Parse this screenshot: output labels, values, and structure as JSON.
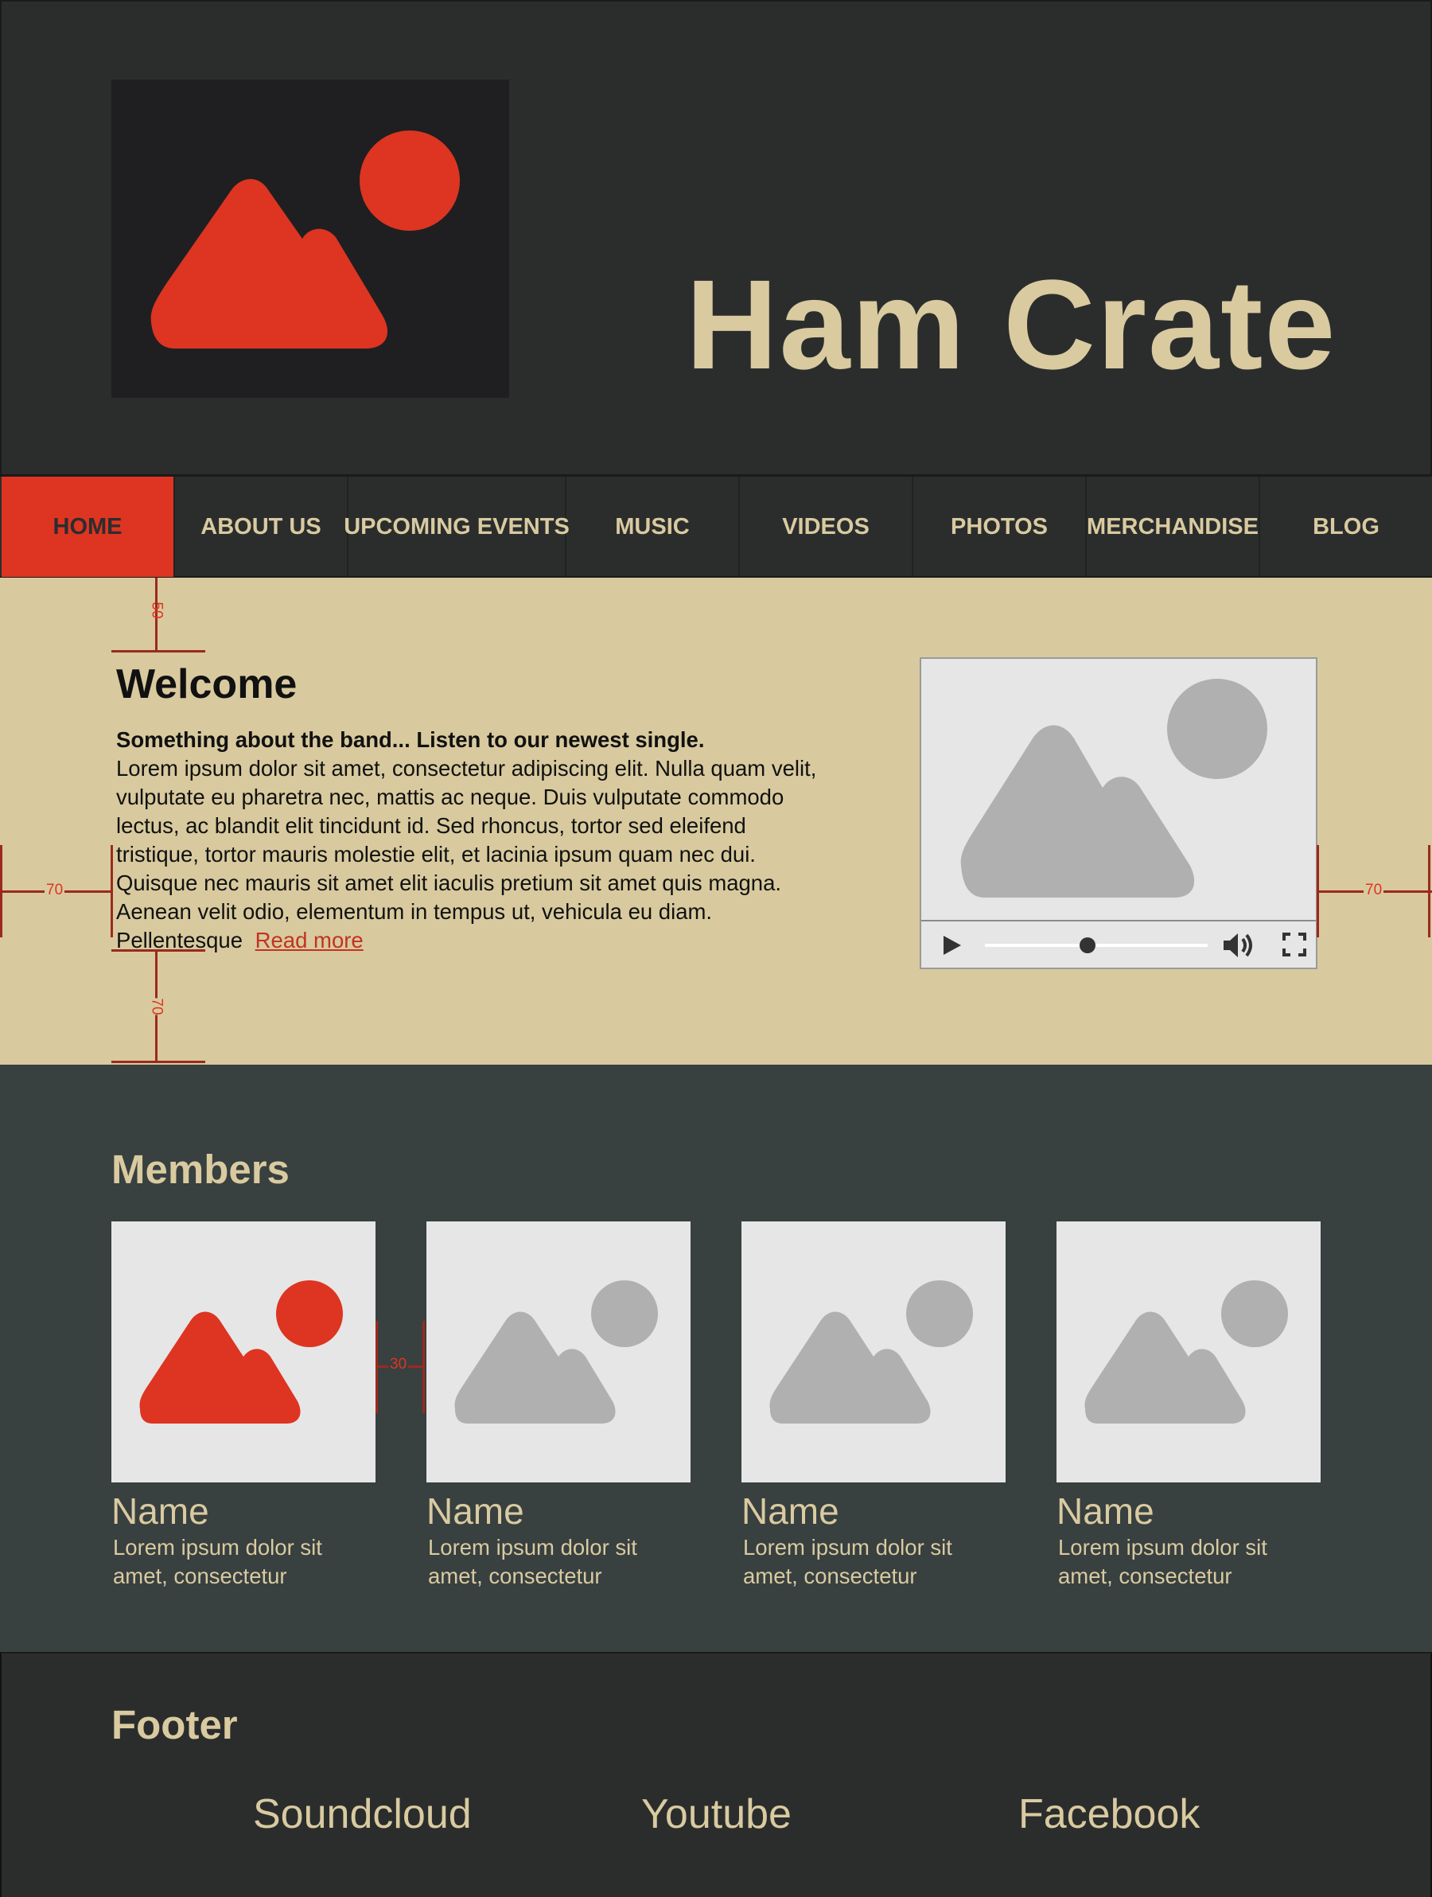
{
  "colors": {
    "background": "#2b2d2d",
    "accent": "#dd3522",
    "beige": "#d9caa0",
    "members_bg": "#384040"
  },
  "header": {
    "title": "Ham Crate",
    "logo_icon": "image-placeholder-icon"
  },
  "nav": {
    "items": [
      {
        "label": "HOME",
        "active": true
      },
      {
        "label": "ABOUT US",
        "active": false
      },
      {
        "label": "UPCOMING EVENTS",
        "active": false
      },
      {
        "label": "MUSIC",
        "active": false
      },
      {
        "label": "VIDEOS",
        "active": false
      },
      {
        "label": "PHOTOS",
        "active": false
      },
      {
        "label": "MERCHANDISE",
        "active": false
      },
      {
        "label": "BLOG",
        "active": false
      }
    ]
  },
  "welcome": {
    "title": "Welcome",
    "lead": "Something about the band... Listen to our newest single.",
    "body": "Lorem ipsum dolor sit amet, consectetur adipiscing elit. Nulla quam velit, vulputate eu pharetra nec, mattis ac neque. Duis vulputate commodo lectus, ac blandit elit tincidunt id. Sed rhoncus, tortor sed eleifend tristique, tortor mauris molestie elit, et lacinia ipsum quam nec dui. Quisque nec mauris sit amet elit iaculis pretium sit amet quis magna. Aenean velit odio, elementum in tempus ut, vehicula eu diam. Pellentesque",
    "read_more": "Read more"
  },
  "video": {
    "progress": 0.46,
    "play_icon": "play-icon",
    "volume_icon": "volume-icon",
    "fullscreen_icon": "fullscreen-icon"
  },
  "annotations": {
    "top_spacing": "50",
    "side_spacing": "70",
    "bottom_spacing": "70",
    "member_gap": "30"
  },
  "members": {
    "title": "Members",
    "items": [
      {
        "name": "Name",
        "desc": "Lorem ipsum dolor sit amet, consectetur"
      },
      {
        "name": "Name",
        "desc": "Lorem ipsum dolor sit amet, consectetur"
      },
      {
        "name": "Name",
        "desc": "Lorem ipsum dolor sit amet, consectetur"
      },
      {
        "name": "Name",
        "desc": "Lorem ipsum dolor sit amet, consectetur"
      }
    ]
  },
  "footer": {
    "title": "Footer",
    "links": [
      "Soundcloud",
      "Youtube",
      "Facebook"
    ]
  }
}
